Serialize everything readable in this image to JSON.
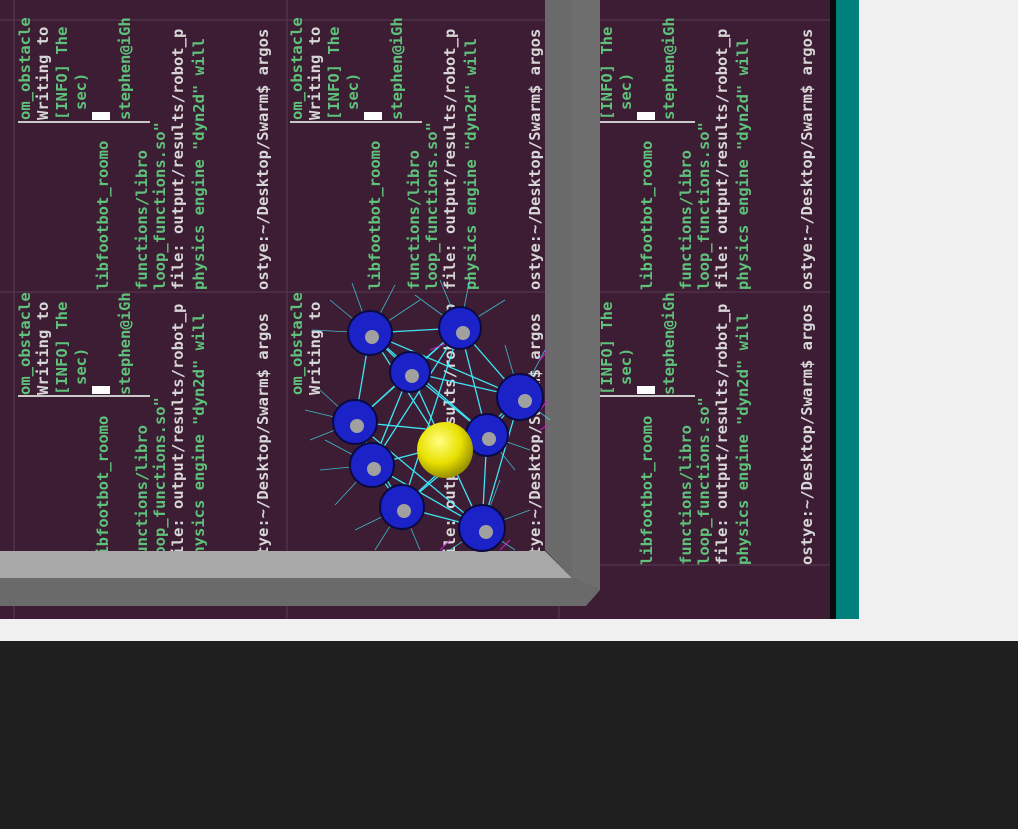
{
  "terminal": {
    "lines_block": [
      "om_obstacle",
      "Writing to",
      "[INFO] The",
      "sec)",
      "libfootbot_roomo",
      "stephen@iGh",
      "functions/libro",
      "loop_functions.so\"",
      "file: output/results/robot_p",
      "physics engine \"dyn2d\" will",
      "stye:~/Desktop/Swarm$ argos",
      "ostye:~/Desktop/Swarm$ argos"
    ],
    "prompt_host": "ostye:",
    "prompt_path": "~/Desktop/Swarm",
    "prompt_cmd": "$ argos"
  },
  "simulation": {
    "robot_color": "#1a22c8",
    "beacon_color": "#e8e000",
    "link_color": "#3df0ff",
    "wall_color_light": "#a8a8a8",
    "wall_color_dark": "#6a6a6a"
  },
  "colors": {
    "terminal_bg": "#3d1d34",
    "teal": "#00807a",
    "bottom_panel": "#1f1f1f"
  }
}
